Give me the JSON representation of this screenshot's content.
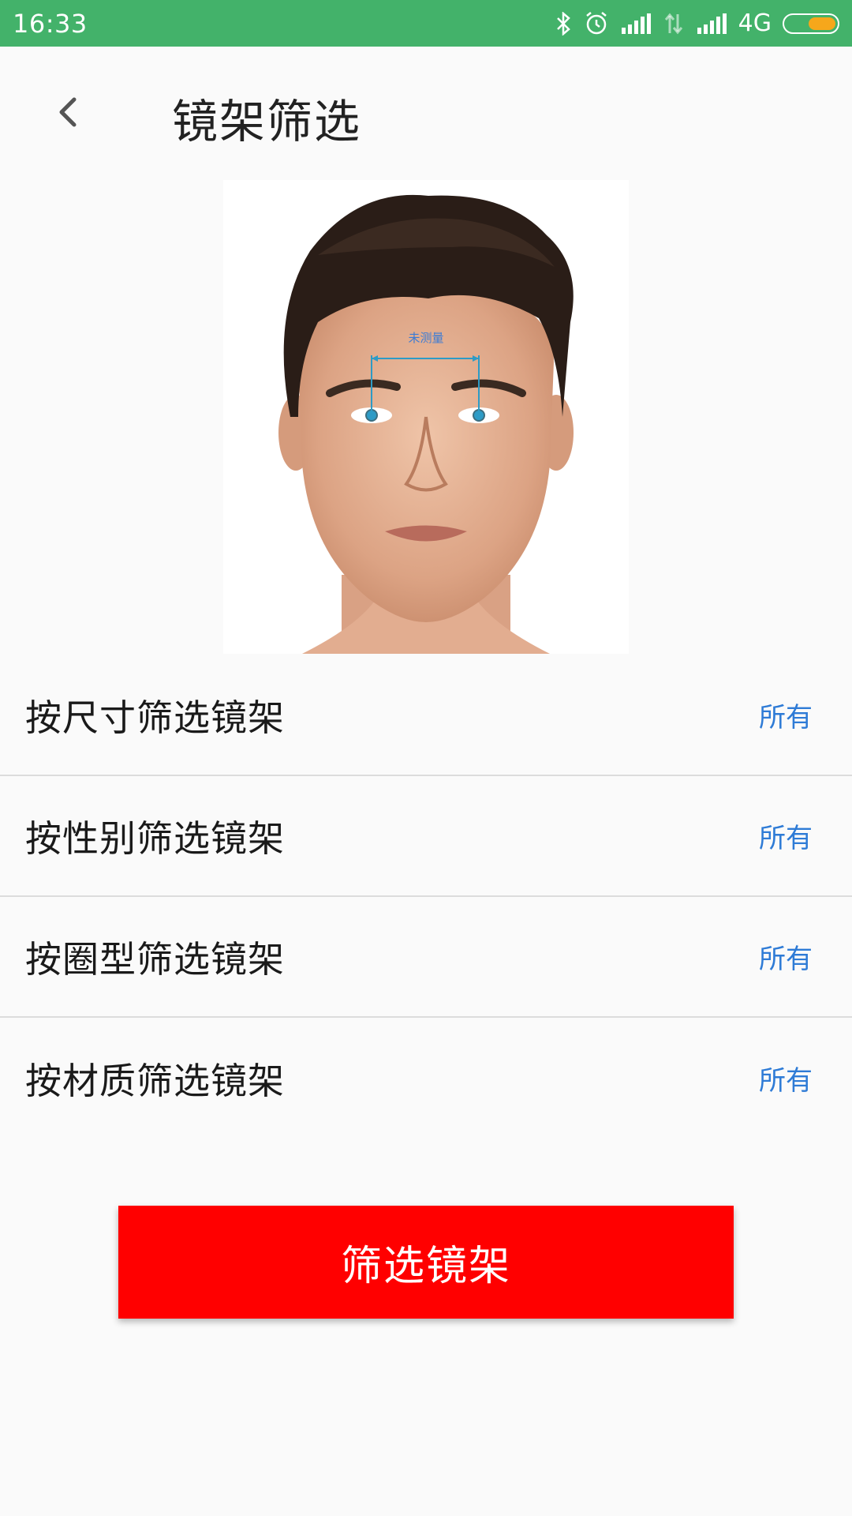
{
  "status_bar": {
    "time": "16:33",
    "network": "4G",
    "icons": [
      "bluetooth-icon",
      "alarm-icon",
      "signal-icon",
      "data-icon",
      "signal-icon",
      "battery-icon"
    ],
    "color": "#43b26a",
    "battery_color": "#f6a71b"
  },
  "app_bar": {
    "back_icon": "chevron-left-icon",
    "title": "镜架筛选"
  },
  "face_image": {
    "measure_label": "未测量"
  },
  "filters": [
    {
      "label": "按尺寸筛选镜架",
      "value": "所有"
    },
    {
      "label": "按性别筛选镜架",
      "value": "所有"
    },
    {
      "label": "按圈型筛选镜架",
      "value": "所有"
    },
    {
      "label": "按材质筛选镜架",
      "value": "所有"
    }
  ],
  "submit_button": {
    "label": "筛选镜架",
    "color": "#ff0000"
  },
  "accent_color": "#2e7bd6"
}
